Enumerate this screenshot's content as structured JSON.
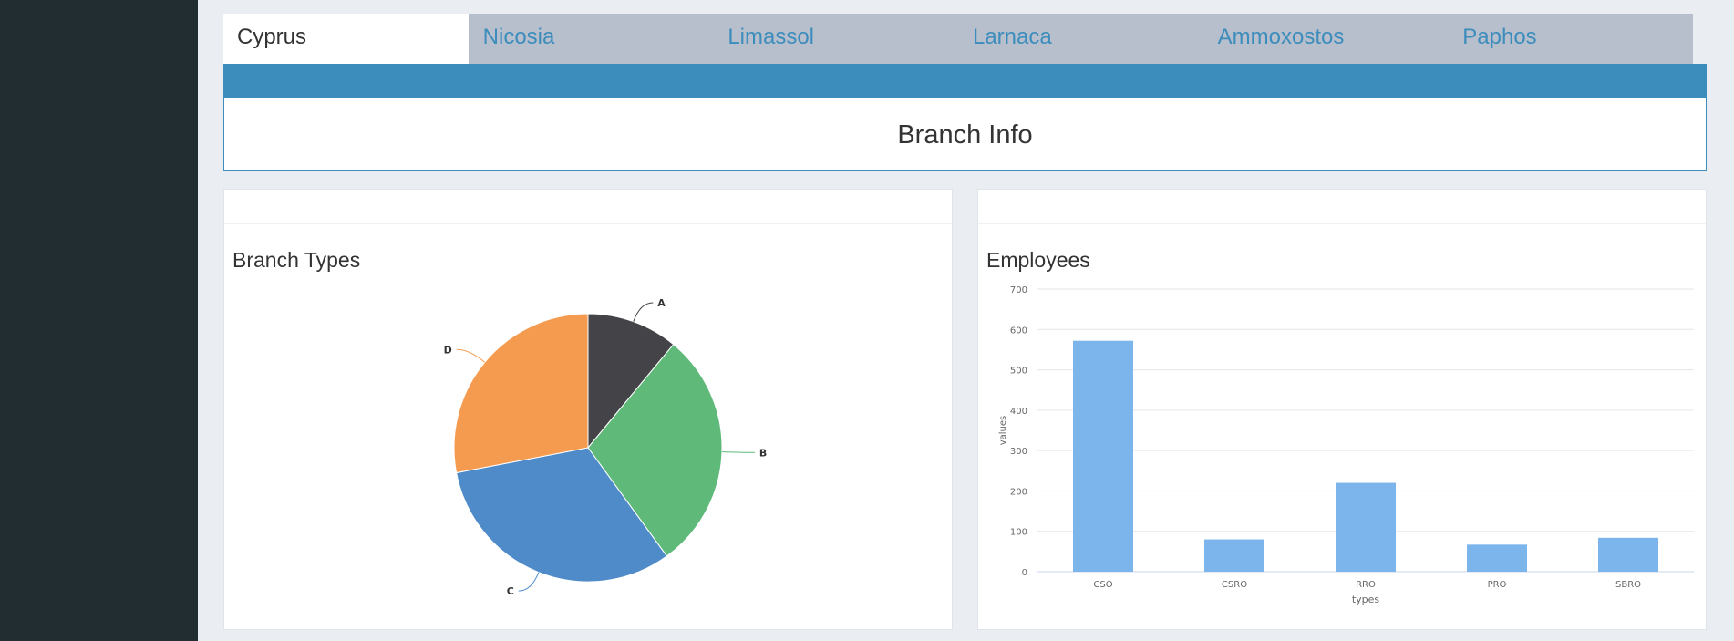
{
  "tabs": [
    "Cyprus",
    "Nicosia",
    "Limassol",
    "Larnaca",
    "Ammoxostos",
    "Paphos"
  ],
  "active_tab": 0,
  "info_box": {
    "title": "Branch Info"
  },
  "panels": {
    "left_title": "Branch Types",
    "right_title": "Employees"
  },
  "colors": {
    "sidebar": "#222d32",
    "accent": "#3c8dbc",
    "tab_bar": "#b8bfcc",
    "bar": "#7cb5ec"
  },
  "chart_data": [
    {
      "type": "pie",
      "title": "Branch Types",
      "labels": [
        "A",
        "B",
        "C",
        "D"
      ],
      "values": [
        11,
        29,
        32,
        28
      ],
      "colors": [
        "#434348",
        "#5fba7a",
        "#4f8bc9",
        "#f49b50"
      ]
    },
    {
      "type": "bar",
      "title": "Employees",
      "categories": [
        "CSO",
        "CSRO",
        "RRO",
        "PRO",
        "SBRO"
      ],
      "values": [
        572,
        80,
        220,
        67,
        84
      ],
      "xlabel": "types",
      "ylabel": "values",
      "ylim": [
        0,
        700
      ],
      "yticks": [
        0,
        100,
        200,
        300,
        400,
        500,
        600,
        700
      ],
      "grid": true
    }
  ]
}
